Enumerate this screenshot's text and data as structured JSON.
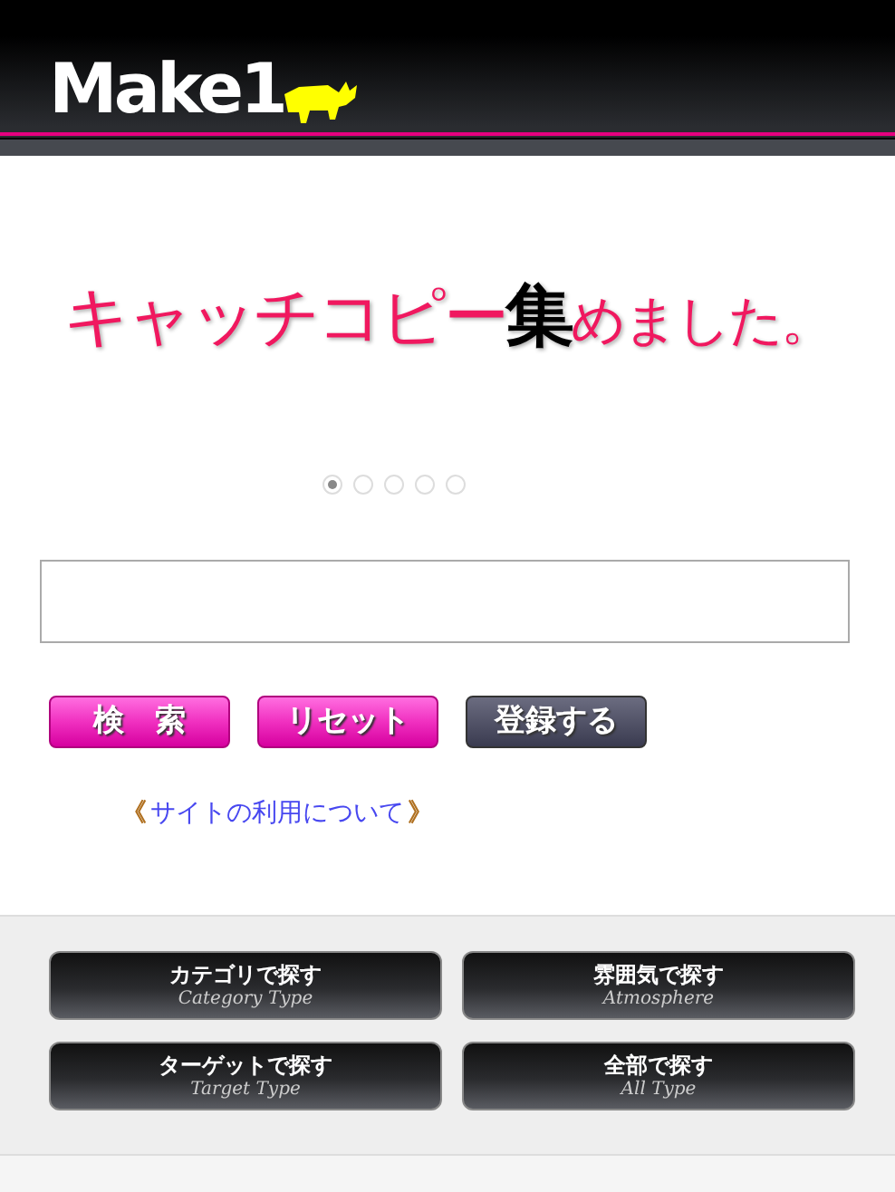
{
  "header": {
    "logo": "Make1"
  },
  "banner": {
    "headline": [
      {
        "text": "キャッチコピー",
        "color": "#f0185f"
      },
      {
        "text": "集",
        "color": "#000000"
      },
      {
        "text": "めました。",
        "color": "#f0185f"
      }
    ],
    "dots": [
      {
        "selected": true
      },
      {
        "selected": false
      },
      {
        "selected": false
      },
      {
        "selected": false
      },
      {
        "selected": false
      }
    ]
  },
  "buttons": [
    {
      "label": "検　索",
      "kind": "pink"
    },
    {
      "label": "リセット",
      "kind": "pink"
    },
    {
      "label": "登録する",
      "kind": "dark"
    }
  ],
  "link": {
    "open": "《",
    "label": "サイトの利用について",
    "close": "》"
  },
  "categories": [
    {
      "title": "カテゴリで探す",
      "subtitle": "Category Type"
    },
    {
      "title": "雰囲気で探す",
      "subtitle": "Atmosphere"
    },
    {
      "title": "ターゲットで探す",
      "subtitle": "Target Type"
    },
    {
      "title": "全部で探す",
      "subtitle": "All Type"
    }
  ]
}
